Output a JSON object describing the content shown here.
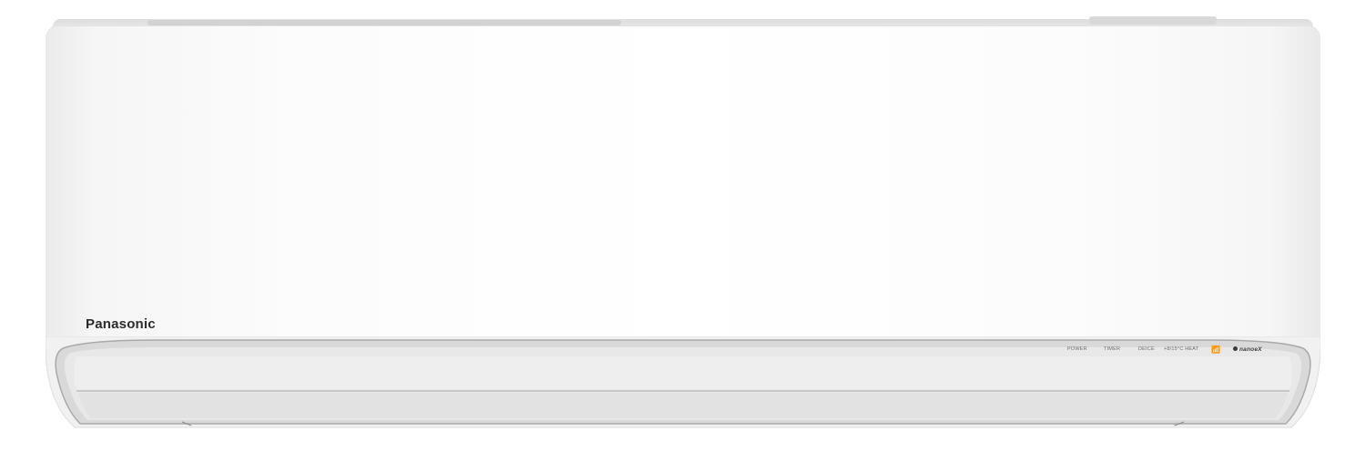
{
  "product": {
    "brand_logo": "Panasonic",
    "colors": {
      "body": "#ffffff",
      "trim": "#c9c9c9",
      "logo": "#2b2b2b"
    }
  },
  "indicators": {
    "power": "POWER",
    "timer": "TIMER",
    "deice": "DEICE",
    "heat": "+8/15°C HEAT",
    "wifi_icon": "wifi-icon",
    "nanoe": "nanoeX"
  }
}
